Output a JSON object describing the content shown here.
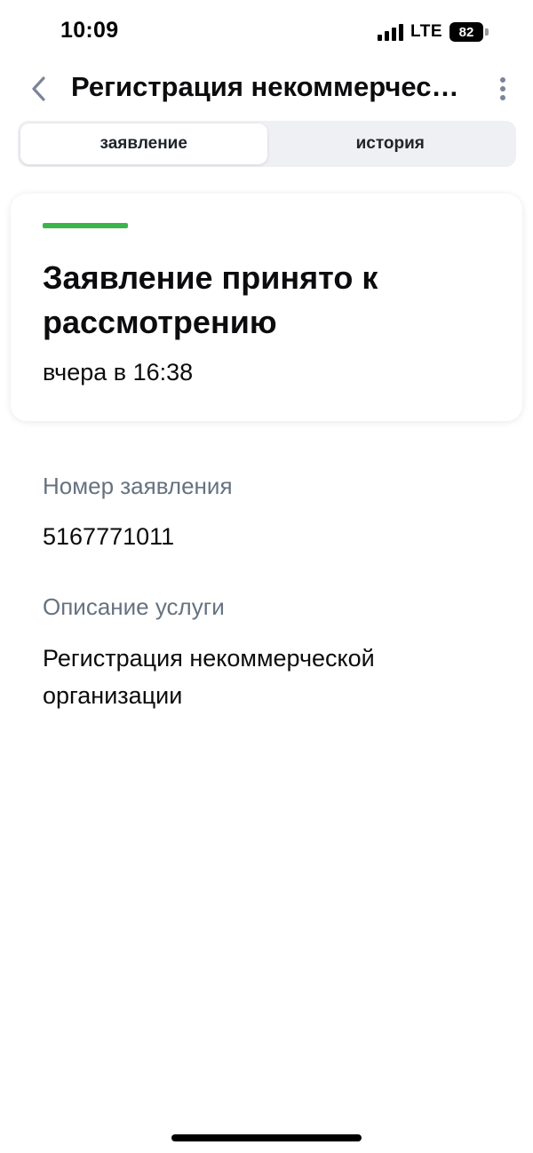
{
  "status_bar": {
    "time": "10:09",
    "network": "LTE",
    "battery": "82"
  },
  "nav": {
    "back_icon": "chevron-left-icon",
    "title": "Регистрация некоммерческой организации",
    "more_icon": "more-vertical-icon"
  },
  "tabs": [
    {
      "label": "заявление",
      "active": true
    },
    {
      "label": "история",
      "active": false
    }
  ],
  "status_card": {
    "accent_color": "#3bb54a",
    "title": "Заявление принято к рассмотрению",
    "time": "вчера в 16:38"
  },
  "details": {
    "number_label": "Номер заявления",
    "number_value": "5167771011",
    "description_label": "Описание услуги",
    "description_value": "Регистрация некоммерческой организации"
  }
}
